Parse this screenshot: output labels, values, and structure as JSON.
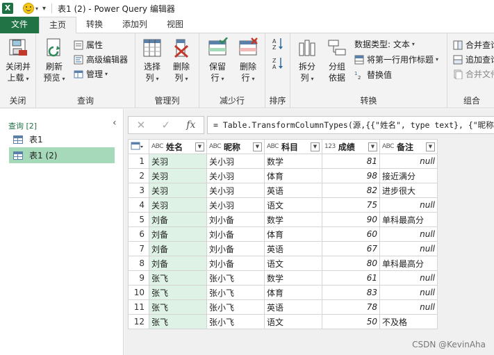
{
  "titlebar": {
    "app_letter": "X",
    "title": "表1 (2) - Power Query 编辑器"
  },
  "tabs": [
    {
      "label": "文件"
    },
    {
      "label": "主页"
    },
    {
      "label": "转换"
    },
    {
      "label": "添加列"
    },
    {
      "label": "视图"
    }
  ],
  "ribbon": {
    "close_load_1": "关闭并",
    "close_load_2": "上载",
    "close_group": "关闭",
    "refresh_1": "刷新",
    "refresh_2": "预览",
    "properties": "属性",
    "advanced_editor": "高级编辑器",
    "manage": "管理",
    "query_group": "查询",
    "choose_cols_1": "选择",
    "choose_cols_2": "列",
    "remove_cols_1": "删除",
    "remove_cols_2": "列",
    "manage_cols_group": "管理列",
    "keep_rows_1": "保留",
    "keep_rows_2": "行",
    "remove_rows_1": "删除",
    "remove_rows_2": "行",
    "reduce_rows_group": "减少行",
    "sort_group": "排序",
    "split_1": "拆分",
    "split_2": "列",
    "group_by_1": "分组",
    "group_by_2": "依据",
    "data_type": "数据类型: 文本",
    "first_row_header": "将第一行用作标题",
    "replace_values": "替换值",
    "transform_group": "转换",
    "merge_queries": "合并查询",
    "append_queries": "追加查询",
    "combine_files": "合并文件",
    "combine_group": "组合"
  },
  "queries": {
    "header": "查询 [2]",
    "items": [
      {
        "label": "表1"
      },
      {
        "label": "表1 (2)"
      }
    ]
  },
  "formula": "= Table.TransformColumnTypes(源,{{\"姓名\", type text}, {\"昵称\",",
  "table": {
    "type_text": "ABC",
    "type_num": "123",
    "columns": [
      "姓名",
      "昵称",
      "科目",
      "成绩",
      "备注"
    ],
    "rows": [
      {
        "n": "1",
        "name": "关羽",
        "nick": "关小羽",
        "subject": "数学",
        "score": "81",
        "note": "null"
      },
      {
        "n": "2",
        "name": "关羽",
        "nick": "关小羽",
        "subject": "体育",
        "score": "98",
        "note": "接近满分"
      },
      {
        "n": "3",
        "name": "关羽",
        "nick": "关小羽",
        "subject": "英语",
        "score": "82",
        "note": "进步很大"
      },
      {
        "n": "4",
        "name": "关羽",
        "nick": "关小羽",
        "subject": "语文",
        "score": "75",
        "note": "null"
      },
      {
        "n": "5",
        "name": "刘备",
        "nick": "刘小备",
        "subject": "数学",
        "score": "90",
        "note": "单科最高分"
      },
      {
        "n": "6",
        "name": "刘备",
        "nick": "刘小备",
        "subject": "体育",
        "score": "60",
        "note": "null"
      },
      {
        "n": "7",
        "name": "刘备",
        "nick": "刘小备",
        "subject": "英语",
        "score": "67",
        "note": "null"
      },
      {
        "n": "8",
        "name": "刘备",
        "nick": "刘小备",
        "subject": "语文",
        "score": "80",
        "note": "单科最高分"
      },
      {
        "n": "9",
        "name": "张飞",
        "nick": "张小飞",
        "subject": "数学",
        "score": "61",
        "note": "null"
      },
      {
        "n": "10",
        "name": "张飞",
        "nick": "张小飞",
        "subject": "体育",
        "score": "83",
        "note": "null"
      },
      {
        "n": "11",
        "name": "张飞",
        "nick": "张小飞",
        "subject": "英语",
        "score": "78",
        "note": "null"
      },
      {
        "n": "12",
        "name": "张飞",
        "nick": "张小飞",
        "subject": "语文",
        "score": "50",
        "note": "不及格"
      }
    ]
  },
  "watermark": "CSDN @KevinAha",
  "colors": {
    "excel_green": "#217346",
    "selected_query": "#a6d9b9",
    "selected_column": "#dff2e6"
  }
}
